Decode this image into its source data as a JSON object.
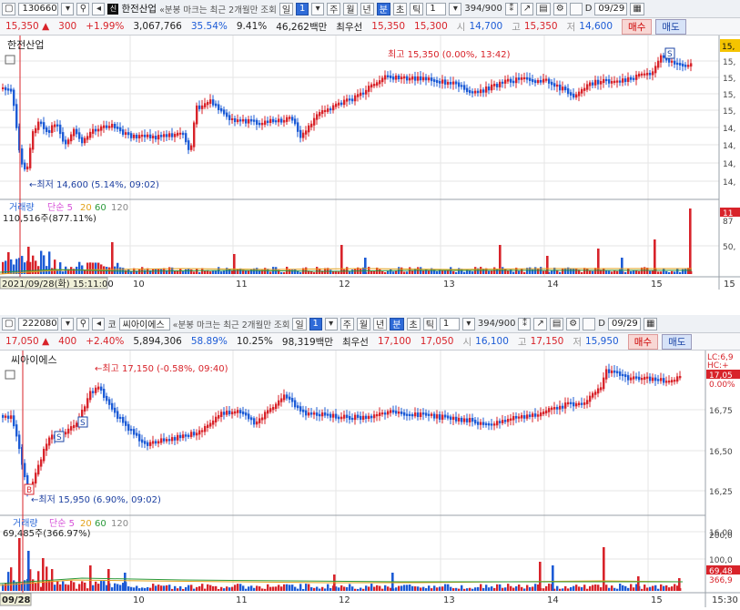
{
  "panels": [
    {
      "toolbar": {
        "code": "130660",
        "name": "한전산업",
        "note": "«분봉 마크는 최근 2개월만 조회",
        "periods": [
          "일",
          "1",
          "주",
          "월",
          "년",
          "분",
          "초",
          "틱"
        ],
        "active_period": "분",
        "interval": "1",
        "count": "394/900",
        "flag_label": "D",
        "date": "09/29"
      },
      "info": {
        "price": "15,350",
        "direction": "▲",
        "change": "300",
        "rate": "+1.99%",
        "volume": "3,067,766",
        "vol_ratio": "35.54%",
        "turnover": "9.41%",
        "amount": "46,262백만",
        "best_label": "최우선",
        "best_ask": "15,350",
        "best_bid": "15,300",
        "open_label": "시",
        "open": "14,700",
        "high_label": "고",
        "high": "15,350",
        "low_label": "저",
        "low": "14,600",
        "buy_label": "매수",
        "sell_label": "매도"
      },
      "chart": {
        "name_label": "한전산업",
        "high_label": "최고 15,350 (0.00%, 13:42)",
        "low_label": "←최저 14,600 (5.14%, 09:02)",
        "y_ticks": [
          "15,",
          "15,",
          "15,",
          "15,",
          "14,",
          "14,",
          "14,",
          "14,"
        ],
        "right_badges": [
          "15,"
        ],
        "volume_legend": [
          "거래량",
          "단순 5",
          "20",
          "60",
          "120"
        ],
        "volume_value": "110,516주(877.11%)",
        "volume_ticks": [
          "87",
          "50,"
        ],
        "volume_badge": "11",
        "x_cursor_label": "2021/09/28(화) 15:11:00",
        "x_ticks": [
          "10",
          "11",
          "12",
          "13",
          "14",
          "15",
          "15"
        ],
        "markers": [
          "S"
        ]
      }
    },
    {
      "toolbar": {
        "code": "222080",
        "market": "코",
        "name": "씨아이에스",
        "note": "«분봉 마크는 최근 2개월만 조회",
        "periods": [
          "일",
          "1",
          "주",
          "월",
          "년",
          "분",
          "초",
          "틱"
        ],
        "active_period": "분",
        "interval": "1",
        "count": "394/900",
        "flag_label": "D",
        "date": "09/29"
      },
      "info": {
        "price": "17,050",
        "direction": "▲",
        "change": "400",
        "rate": "+2.40%",
        "volume": "5,894,306",
        "vol_ratio": "58.89%",
        "turnover": "10.25%",
        "amount": "98,319백만",
        "best_label": "최우선",
        "best_ask": "17,100",
        "best_bid": "17,050",
        "open_label": "시",
        "open": "16,100",
        "high_label": "고",
        "high": "17,150",
        "low_label": "저",
        "low": "15,950",
        "buy_label": "매수",
        "sell_label": "매도"
      },
      "chart": {
        "name_label": "씨아이에스",
        "high_label": "←최고 17,150 (-0.58%, 09:40)",
        "low_label": "←최저 15,950 (6.90%, 09:02)",
        "y_ticks": [
          "16,75",
          "16,50",
          "16,25",
          "16,00"
        ],
        "right_badges": [
          "LC:6,9",
          "HC:+",
          "17,05",
          "0.00%"
        ],
        "volume_legend": [
          "거래량",
          "단순 5",
          "20",
          "60",
          "120"
        ],
        "volume_value": "69,485주(366.97%)",
        "volume_ticks": [
          "200,0",
          "100,0"
        ],
        "volume_badge": "69,48",
        "volume_badge2": "366,9",
        "x_cursor_label": "09/28",
        "x_ticks": [
          "10",
          "11",
          "12",
          "13",
          "14",
          "15",
          "15:30"
        ],
        "markers": [
          "S",
          "S",
          "B"
        ]
      }
    }
  ],
  "colors": {
    "up": "#d8232a",
    "down": "#1c5bd6",
    "ma5": "#d64fd8",
    "ma20": "#e3a21a",
    "ma60": "#2a9a3a",
    "ma120": "#8a8a8a",
    "accent": "#2f6bd8"
  }
}
